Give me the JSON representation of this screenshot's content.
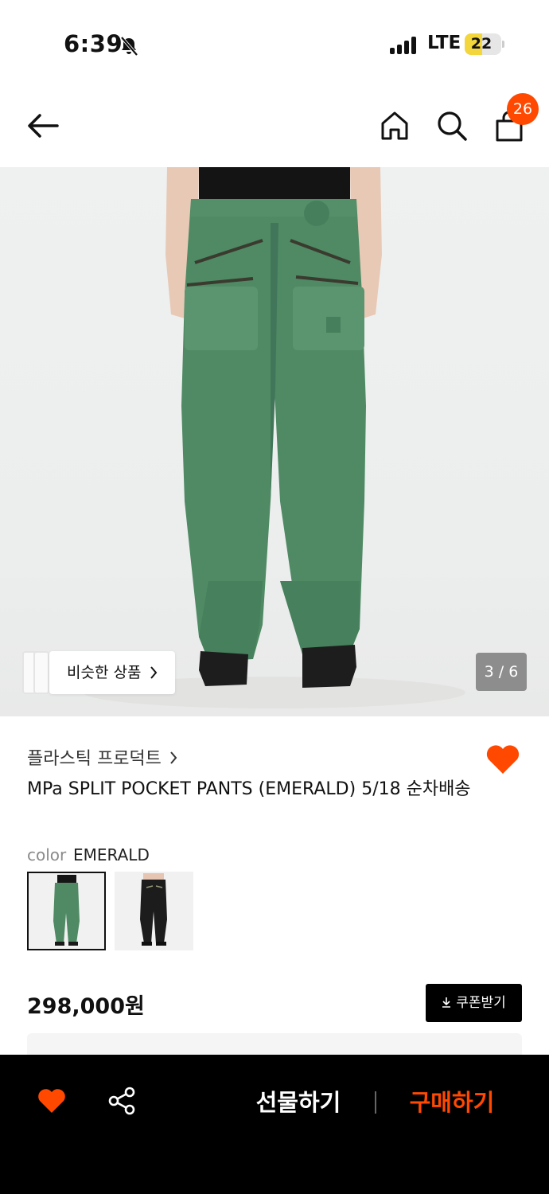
{
  "status_bar": {
    "time": "6:39",
    "network": "LTE",
    "battery": "22",
    "icons": [
      "bell-slash-icon",
      "signal-icon"
    ]
  },
  "nav": {
    "icons": [
      "back-arrow-icon",
      "home-icon",
      "search-icon",
      "shopping-bag-icon"
    ],
    "cart_count": "26"
  },
  "gallery": {
    "similar_button": "비슷한 상품",
    "page_indicator": "3 / 6"
  },
  "product": {
    "brand": "플라스틱 프로덕트",
    "title": "MPa SPLIT POCKET PANTS (EMERALD) 5/18 순차배송",
    "color_label": "color",
    "color_value": "EMERALD",
    "price": "298,000원",
    "coupon_button": "쿠폰받기",
    "wishlisted": true
  },
  "bottom_bar": {
    "gift_label": "선물하기",
    "buy_label": "구매하기",
    "icons": [
      "heart-icon",
      "share-icon"
    ]
  },
  "colors": {
    "accent": "#ff4800",
    "pants": "#4f8a64",
    "bottom_bar": "#000000"
  }
}
